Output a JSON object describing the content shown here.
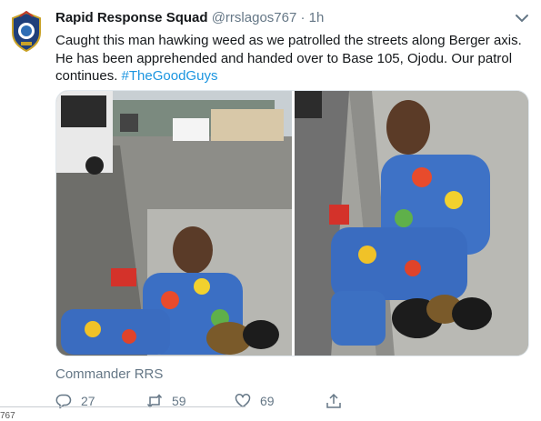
{
  "tweet": {
    "author_name": "Rapid Response Squad",
    "handle": "@rrslagos767",
    "separator": "·",
    "time": "1h",
    "text_main": "Caught this man hawking weed as we patrolled the streets along Berger axis. He has been apprehended and handed over to  Base 105, Ojodu. Our patrol continues. ",
    "hashtag": "#TheGoodGuys",
    "source": "Commander RRS"
  },
  "actions": {
    "reply_count": "27",
    "retweet_count": "59",
    "like_count": "69"
  },
  "edge_text": "767",
  "colors": {
    "text": "#14171a",
    "secondary": "#657786",
    "link": "#1b95e0",
    "border": "#e1e8ed"
  },
  "icons": {
    "avatar": "police-badge-avatar",
    "menu": "chevron-down-icon",
    "reply": "reply-icon",
    "retweet": "retweet-icon",
    "like": "heart-icon",
    "share": "share-icon"
  }
}
